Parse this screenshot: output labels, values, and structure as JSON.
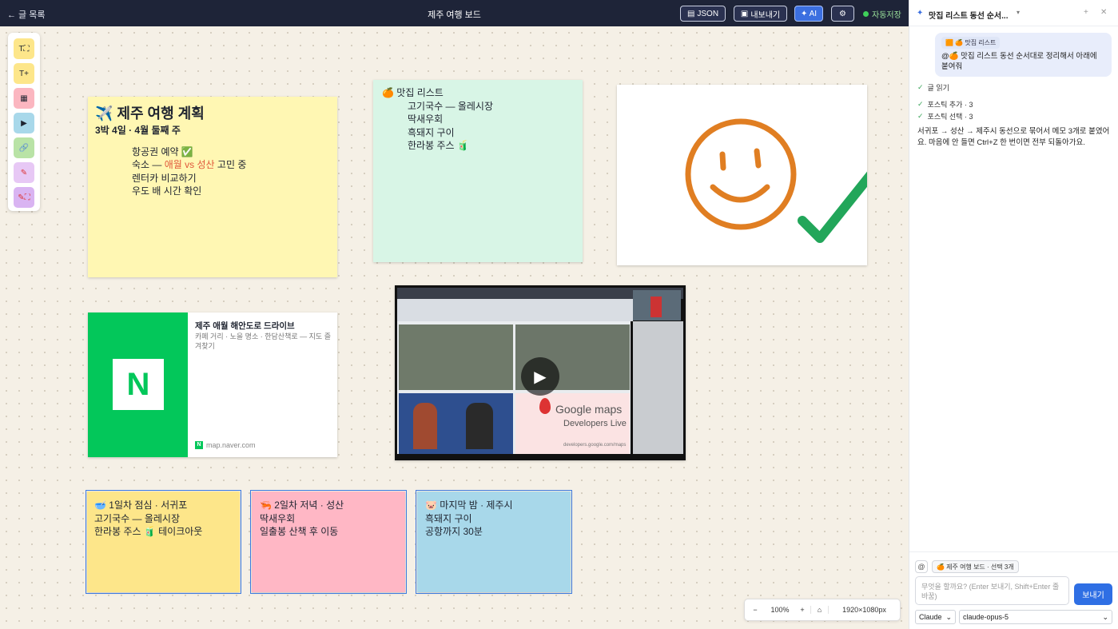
{
  "topbar": {
    "back": "← 글 목록",
    "title": "제주 여행 보드",
    "json": "JSON",
    "export": "내보내기",
    "ai": "✦ AI",
    "autosave": "자동저장"
  },
  "colors": {
    "topbar": "#1e2438",
    "accent": "#2f6fe4",
    "canvas": "#f5f0e6",
    "sticky_yellow": "#fff7b3",
    "sticky_mint": "#d8f5e6",
    "sticky_orange": "#fde68a",
    "sticky_pink": "#ffb7c5",
    "sticky_blue": "#a8d8ea"
  },
  "tools": [
    {
      "icon": "text-frame-icon",
      "glyph": "T⛶"
    },
    {
      "icon": "text-plus-icon",
      "glyph": "T+"
    },
    {
      "icon": "image-icon",
      "glyph": "▦"
    },
    {
      "icon": "video-icon",
      "glyph": "▶"
    },
    {
      "icon": "link-icon",
      "glyph": "🔗"
    },
    {
      "icon": "pen-icon",
      "glyph": "✎"
    },
    {
      "icon": "pen-select-icon",
      "glyph": "✎⛶"
    }
  ],
  "plan": {
    "title": "✈️ 제주 여행 계획",
    "sub": "3박 4일 · 4월 둘째 주",
    "l1": "항공권 예약 ✅",
    "l2a": "숙소 — ",
    "l2b": "애월 vs 성산",
    "l2c": " 고민 중",
    "l3": "렌터카 비교하기",
    "l4": "우도 배 시간 확인"
  },
  "food": {
    "title": "🍊 맛집 리스트",
    "l1": "고기국수 — 올레시장",
    "l2": "딱새우회",
    "l3": "흑돼지 구이",
    "l4": "한라봉 주스 🧃"
  },
  "link": {
    "title": "제주 애월 해안도로 드라이브",
    "desc": "카페 거리 · 노을 명소 · 한담산책로 — 지도 즐겨찾기",
    "url": "map.naver.com",
    "logo": "N"
  },
  "video": {
    "brand1": "Google maps",
    "brand2": "Developers Live",
    "site": "developers.google.com/maps"
  },
  "day1": {
    "title": "🥣 1일차 점심 · 서귀포",
    "l1": "고기국수 — 올레시장",
    "l2": "한라봉 주스 🧃 테이크아웃"
  },
  "day2": {
    "title": "🦐 2일차 저녁 · 성산",
    "l1": "딱새우회",
    "l2": "일출봉 산책 후 이동"
  },
  "day3": {
    "title": "🐷 마지막 밤 · 제주시",
    "l1": "흑돼지 구이",
    "l2": "공항까지 30분"
  },
  "zoom": {
    "minus": "−",
    "level": "100%",
    "plus": "+",
    "home": "⌂",
    "size": "1920×1080px"
  },
  "panel": {
    "title": "맛집 리스트 동선 순서...",
    "chip": "🟧 🍊 맛집 리스트",
    "msg": "@🍊 맛집 리스트 동선 순서대로 정리해서 아래에 붙여줘",
    "step1": "글 읽기",
    "step2": "포스틱 추가 · 3",
    "step3": "포스틱 선택 · 3",
    "reply": "서귀포 → 성산 → 제주시 동선으로 묶어서 메모 3개로 붙였어요. 마음에 안 들면 Ctrl+Z 한 번이면 전부 되돌아가요.",
    "ctx": "🍊 제주 여행 보드 · 선택 3개",
    "placeholder": "무엇을 할까요? (Enter 보내기, Shift+Enter 줄바꿈)",
    "send": "보내기",
    "provider": "Claude",
    "model": "claude-opus-5"
  }
}
